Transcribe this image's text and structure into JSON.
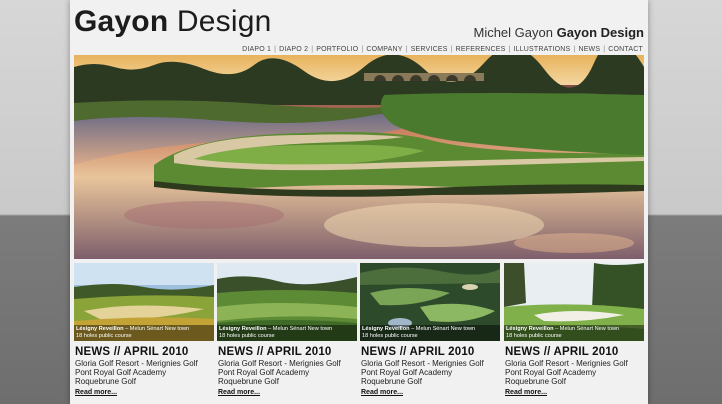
{
  "header": {
    "logo_bold": "Gayon",
    "logo_rest": " Design",
    "tagline_regular": "Michel Gayon ",
    "tagline_bold": "Gayon Design"
  },
  "nav": {
    "items": [
      "DIAPO 1",
      "DIAPO 2",
      "PORTFOLIO",
      "COMPANY",
      "SERVICES",
      "REFERENCES",
      "ILLUSTRATIONS",
      "NEWS",
      "CONTACT"
    ],
    "separator": "|"
  },
  "hero": {
    "alt": "golf course at sunset with lake and stone bridge"
  },
  "thumbnails": [
    {
      "caption_bold": "Lésigny Reveillon",
      "caption_rest": " – Melun Sénart New town",
      "caption_line2": "18 holes public course"
    },
    {
      "caption_bold": "Lésigny Reveillon",
      "caption_rest": " – Melun Sénart New town",
      "caption_line2": "18 holes public course"
    },
    {
      "caption_bold": "Lésigny Reveillon",
      "caption_rest": " – Melun Sénart New town",
      "caption_line2": "18 holes public course"
    },
    {
      "caption_bold": "Lésigny Reveillon",
      "caption_rest": " – Melun Sénart New town",
      "caption_line2": "18 holes public course"
    }
  ],
  "news": [
    {
      "heading": "NEWS // APRIL 2010",
      "lines": [
        "Gloria Golf Resort - Merignies Golf",
        "Pont Royal Golf Academy",
        "Roquebrune Golf"
      ],
      "more": "Read more..."
    },
    {
      "heading": "NEWS // APRIL 2010",
      "lines": [
        "Gloria Golf Resort - Merignies Golf",
        "Pont Royal Golf Academy",
        "Roquebrune Golf"
      ],
      "more": "Read more..."
    },
    {
      "heading": "NEWS // APRIL 2010",
      "lines": [
        "Gloria Golf Resort - Merignies Golf",
        "Pont Royal Golf Academy",
        "Roquebrune Golf"
      ],
      "more": "Read more..."
    },
    {
      "heading": "NEWS // APRIL 2010",
      "lines": [
        "Gloria Golf Resort - Merignies Golf",
        "Pont Royal Golf Academy",
        "Roquebrune Golf"
      ],
      "more": "Read more..."
    }
  ]
}
